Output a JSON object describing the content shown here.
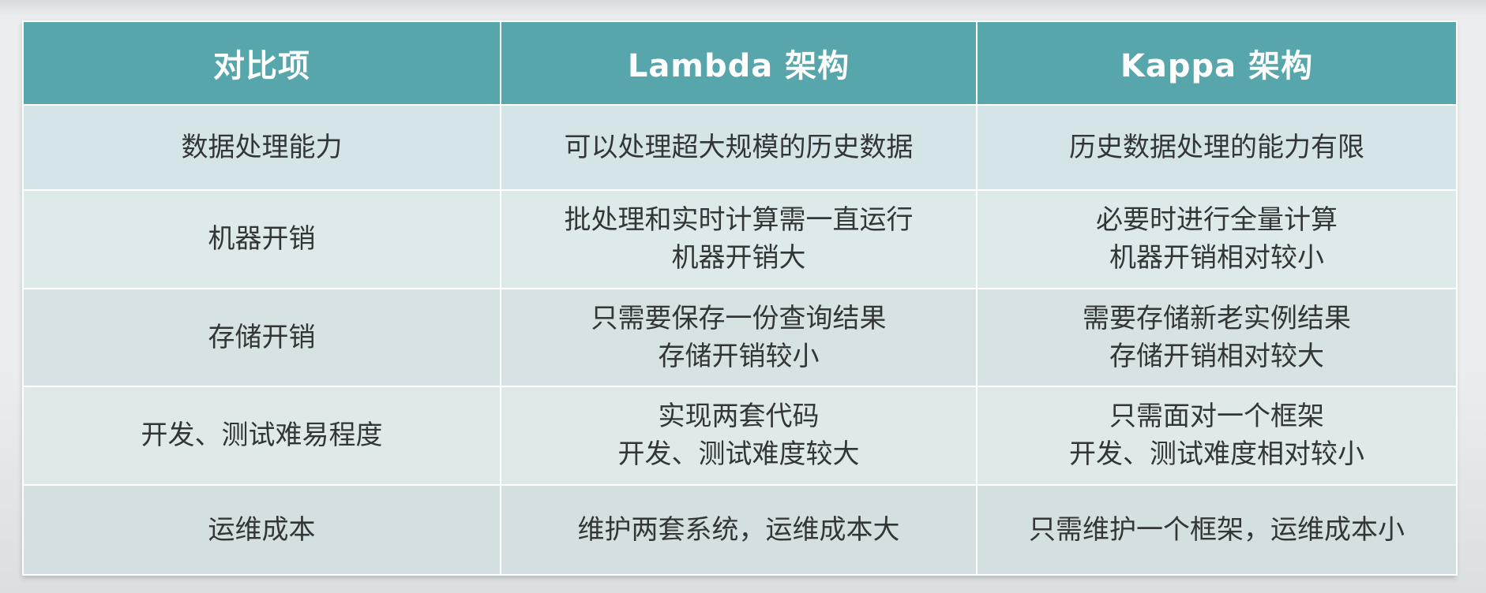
{
  "table": {
    "headers": [
      "对比项",
      "Lambda 架构",
      "Kappa 架构"
    ],
    "rows": [
      {
        "item": [
          "数据处理能力"
        ],
        "lambda": [
          "可以处理超大规模的历史数据"
        ],
        "kappa": [
          "历史数据处理的能力有限"
        ]
      },
      {
        "item": [
          "机器开销"
        ],
        "lambda": [
          "批处理和实时计算需一直运行",
          "机器开销大"
        ],
        "kappa": [
          "必要时进行全量计算",
          "机器开销相对较小"
        ]
      },
      {
        "item": [
          "存储开销"
        ],
        "lambda": [
          "只需要保存一份查询结果",
          "存储开销较小"
        ],
        "kappa": [
          "需要存储新老实例结果",
          "存储开销相对较大"
        ]
      },
      {
        "item": [
          "开发、测试难易程度"
        ],
        "lambda": [
          "实现两套代码",
          "开发、测试难度较大"
        ],
        "kappa": [
          "只需面对一个框架",
          "开发、测试难度相对较小"
        ]
      },
      {
        "item": [
          "运维成本"
        ],
        "lambda": [
          "维护两套系统，运维成本大"
        ],
        "kappa": [
          "只需维护一个框架，运维成本小"
        ]
      }
    ]
  },
  "colors": {
    "header_bg": "#56a6ab",
    "header_text": "#ffffff",
    "cell_bg": "#d8e5e7",
    "cell_text": "#333638"
  }
}
